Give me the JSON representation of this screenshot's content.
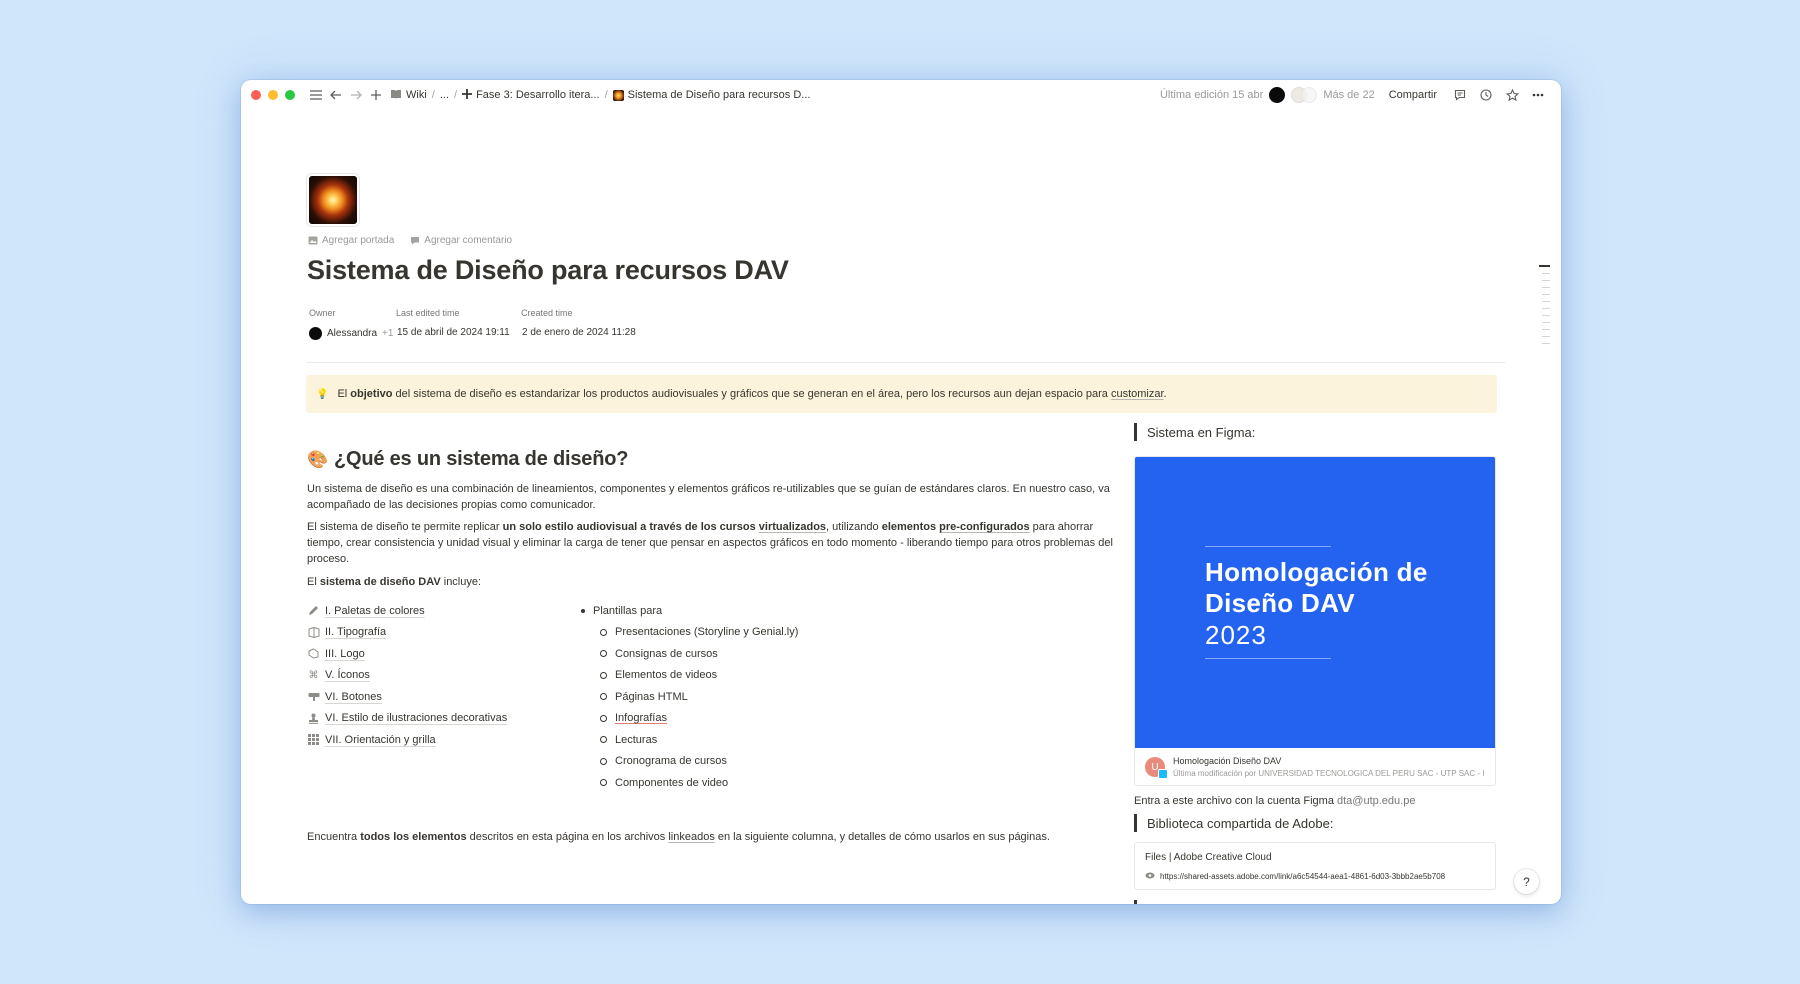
{
  "colors": {
    "background": "#cfe6fb",
    "callout_bg": "#fbf3db",
    "figma_blue": "#2363f0",
    "traffic_red": "#ff5f57",
    "traffic_yellow": "#febc2e",
    "traffic_green": "#28c840"
  },
  "topbar": {
    "breadcrumbs": [
      {
        "icon": "book-icon",
        "label": "Wiki"
      },
      {
        "icon": "",
        "label": "..."
      },
      {
        "icon": "plus-icon",
        "label": "Fase 3: Desarrollo itera..."
      },
      {
        "icon": "sparkler-icon",
        "label": "Sistema de Diseño para recursos D..."
      }
    ],
    "last_edit": "Última edición 15 abr",
    "more_count": "Más de 22",
    "share_label": "Compartir"
  },
  "page": {
    "add_cover": "Agregar portada",
    "add_comment": "Agregar comentario",
    "title": "Sistema de Diseño para recursos DAV",
    "properties": {
      "owner_label": "Owner",
      "owner_value": "Alessandra",
      "owner_extra": "+1",
      "edited_label": "Last edited time",
      "edited_value": "15 de abril de 2024 19:11",
      "created_label": "Created time",
      "created_value": "2 de enero de 2024 11:28"
    },
    "callout": {
      "icon": "lightbulb-icon",
      "t1": "El ",
      "b1": "objetivo",
      "t2": " del sistema de diseño es estandarizar los productos audiovisuales y gráficos que se generan en el área, pero los recursos aun dejan espacio para ",
      "u1": "customizar",
      "t3": "."
    },
    "section_heading": "¿Qué es un sistema de diseño?",
    "section_icon": "palette-icon",
    "p1": "Un sistema de diseño es una combinación de lineamientos, componentes y elementos gráficos re-utilizables que se guían de estándares claros. En nuestro caso, va acompañado de las decisiones propias como comunicador.",
    "p2": {
      "t1": "El sistema de diseño te permite replicar ",
      "b1": "un solo estilo audiovisual a través de los cursos ",
      "b1u": "virtualizados",
      "t2": ", utilizando ",
      "b2": "elementos ",
      "b2u": "pre-configurados",
      "t3": " para ahorrar tiempo, crear consistencia y unidad visual y eliminar la carga de tener que pensar en aspectos gráficos en todo momento - liberando tiempo para otros problemas del proceso."
    },
    "p3": {
      "t1": "El ",
      "b1": "sistema de diseño DAV",
      "t2": " incluye:"
    },
    "links": [
      {
        "icon": "pencil-icon",
        "label": "I. Paletas de colores"
      },
      {
        "icon": "typography-icon",
        "label": "II. Tipografía"
      },
      {
        "icon": "logo-icon",
        "label": "III. Logo"
      },
      {
        "icon": "command-icon",
        "label": "V. Íconos"
      },
      {
        "icon": "button-icon",
        "label": "VI. Botones"
      },
      {
        "icon": "stamp-icon",
        "label": "VI. Estilo de ilustraciones decorativas"
      },
      {
        "icon": "grid-icon",
        "label": "VII. Orientación y grilla"
      }
    ],
    "bullets_title": "Plantillas para",
    "bullets": [
      "Presentaciones (Storyline y Genial.ly)",
      "Consignas de cursos",
      "Elementos de videos",
      "Páginas HTML",
      "Infografías",
      "Lecturas",
      "Cronograma de cursos",
      "Componentes de video"
    ],
    "footer": {
      "t1": "Encuentra ",
      "b1": "todos los elementos",
      "t2": " descritos en esta página en los archivos ",
      "u1": "linkeados",
      "t3": " en la siguiente columna, y detalles de cómo usarlos en sus páginas."
    }
  },
  "sidecol": {
    "figma_heading": "Sistema en Figma:",
    "figma_art_line1": "Homologación de",
    "figma_art_line2": "Diseño DAV",
    "figma_art_year": "2023",
    "figma_avatar_letter": "U",
    "figma_name": "Homologación Diseño DAV",
    "figma_sub": "Última modificación por UNIVERSIDAD TECNOLOGICA DEL PERU SAC - UTP SAC - I",
    "figma_note": "Entra a este archivo con la cuenta Figma ",
    "figma_email": "dta@utp.edu.pe",
    "adobe_heading": "Biblioteca compartida de Adobe:",
    "adobe_name": "Files | Adobe Creative Cloud",
    "adobe_url": "https://shared-assets.adobe.com/link/a6c54544-aea1-4861-6d03-3bbb2ae5b708"
  },
  "help_label": "?"
}
